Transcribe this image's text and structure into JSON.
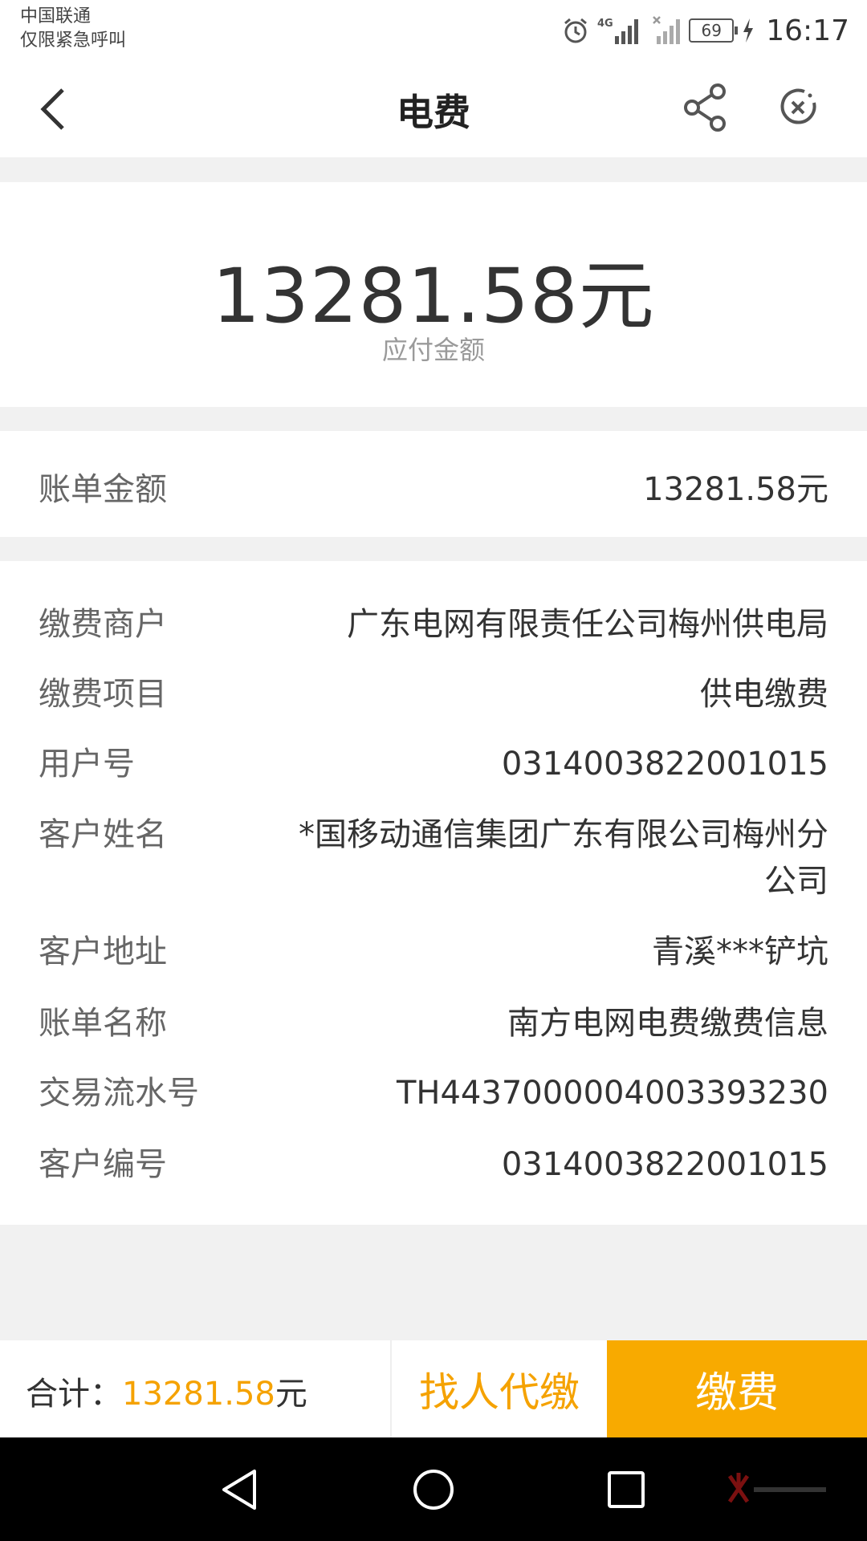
{
  "status_bar": {
    "carrier_line1": "中国联通",
    "carrier_line2": "仅限紧急呼叫",
    "network": "4G",
    "battery": "69",
    "time": "16:17"
  },
  "header": {
    "title": "电费"
  },
  "amount": {
    "value": "13281.58元",
    "caption": "应付金额"
  },
  "bill": {
    "label": "账单金额",
    "value": "13281.58元"
  },
  "details": [
    {
      "label": "缴费商户",
      "value": "广东电网有限责任公司梅州供电局"
    },
    {
      "label": "缴费项目",
      "value": "供电缴费"
    },
    {
      "label": "用户号",
      "value": "0314003822001015"
    },
    {
      "label": "客户姓名",
      "value": "*国移动通信集团广东有限公司梅州分公司"
    },
    {
      "label": "客户地址",
      "value": "青溪***铲坑"
    },
    {
      "label": "账单名称",
      "value": "南方电网电费缴费信息"
    },
    {
      "label": "交易流水号",
      "value": "TH4437000004003393230"
    },
    {
      "label": "客户编号",
      "value": "0314003822001015"
    }
  ],
  "bottom_bar": {
    "total_label": "合计：",
    "total_value": "13281.58",
    "total_unit": "元",
    "proxy_button": "找人代缴",
    "pay_button": "缴费"
  },
  "colors": {
    "accent": "#f8aa00",
    "accent_text": "#f5a200",
    "background": "#f1f1f1"
  }
}
